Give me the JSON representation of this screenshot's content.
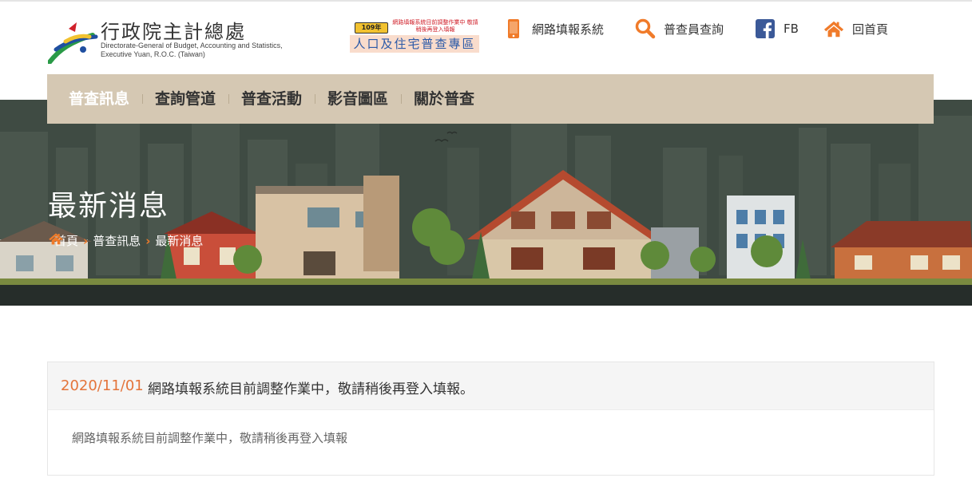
{
  "header": {
    "logo_title": "行政院主計總處",
    "logo_sub_line1": "Directorate-General of Budget, Accounting and Statistics,",
    "logo_sub_line2": "Executive Yuan, R.O.C. (Taiwan)",
    "promo_badge": "109年",
    "promo_note": "網路填報系統目前調整作業中 敬請稍後再登入填報",
    "promo_label": "人口及住宅普查專區",
    "links": [
      {
        "label": "網路填報系統",
        "icon": "mobile-phone-icon",
        "color": "#f07b2a"
      },
      {
        "label": "普查員查詢",
        "icon": "search-icon",
        "color": "#f07b2a"
      },
      {
        "label": "FB",
        "icon": "facebook-icon",
        "color": "#3b5998"
      },
      {
        "label": "回首頁",
        "icon": "home-icon",
        "color": "#f07b2a"
      }
    ]
  },
  "nav": {
    "items": [
      {
        "label": "普查訊息",
        "active": true
      },
      {
        "label": "查詢管道",
        "active": false
      },
      {
        "label": "普查活動",
        "active": false
      },
      {
        "label": "影音圖區",
        "active": false
      },
      {
        "label": "關於普查",
        "active": false
      }
    ],
    "bg_color": "#d5c8b3"
  },
  "banner": {
    "title": "最新消息",
    "breadcrumb": [
      "首頁",
      "普查訊息",
      "最新消息"
    ],
    "home_icon": "home-icon",
    "separator_icon": "chevron-right-icon"
  },
  "posts": [
    {
      "date": "2020/11/01",
      "title": "網路填報系統目前調整作業中，敬請稍後再登入填報。",
      "body": "網路填報系統目前調整作業中，敬請稍後再登入填報"
    }
  ],
  "colors": {
    "accent": "#f07b2a",
    "link_blue": "#2c5aa8"
  }
}
